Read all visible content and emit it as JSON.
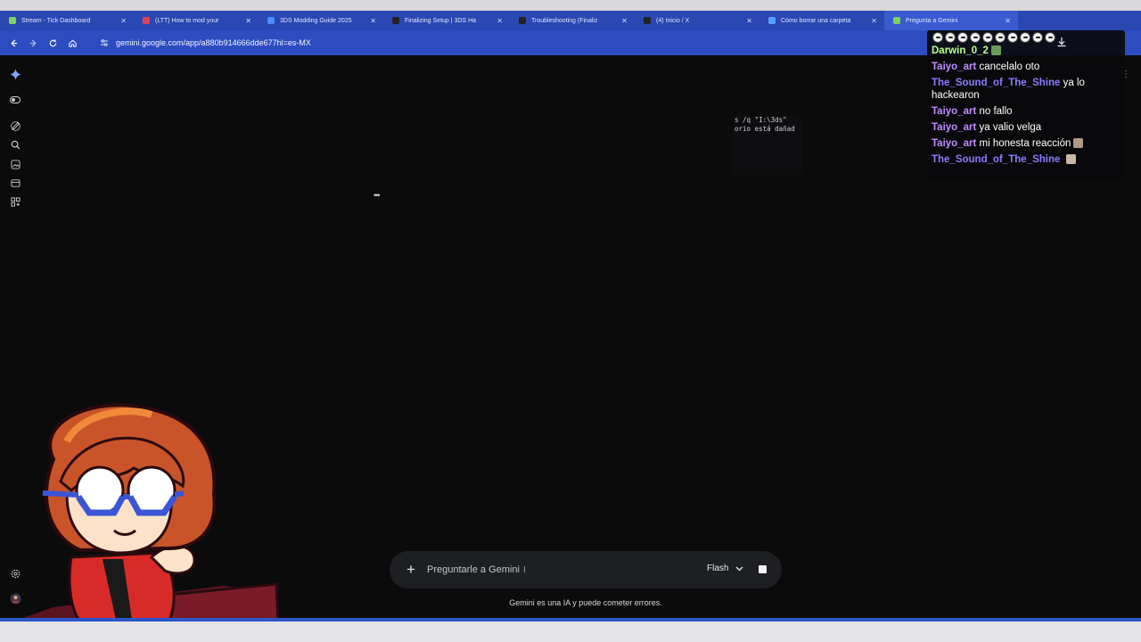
{
  "browser": {
    "tabs": [
      {
        "label": "Stream - Tick Dashboard",
        "color": "#7bd35a"
      },
      {
        "label": "(LTT) How to mod your",
        "color": "#e0405a"
      },
      {
        "label": "3DS Modding Guide 2025",
        "color": "#4a8cff"
      },
      {
        "label": "Finalizing Setup | 3DS Ha",
        "color": "#222222"
      },
      {
        "label": "Troubleshooting (Finaliz",
        "color": "#222222"
      },
      {
        "label": "(4) Inicio / X",
        "color": "#222222"
      },
      {
        "label": "Cómo borrar una carpeta",
        "color": "#5aa0ff"
      },
      {
        "label": "Pregunta a Gemini",
        "color": "#7bd35a"
      }
    ],
    "url": "gemini.google.com/app/a880b914666dde677hl=es-MX",
    "icons": {
      "back": "arrow-left-icon",
      "forward": "arrow-right-icon",
      "reload": "reload-icon",
      "home": "home-icon",
      "site_info": "tune-icon",
      "download": "download-icon",
      "menu": "kebab-icon"
    }
  },
  "rail": {
    "icons": [
      "gemini-star-icon",
      "toggle-icon",
      "new-chat-icon",
      "search-icon",
      "gallery-icon",
      "library-icon",
      "apps-icon",
      "settings-icon",
      "user-avatar-icon"
    ]
  },
  "terminal": {
    "lines": [
      "s /q \"I:\\3ds\"",
      "orio está dañad"
    ]
  },
  "loader_text": "•••",
  "chat": {
    "header_user": "Darwin_0_2",
    "messages": [
      {
        "user": "Taiyo_art",
        "user_color": "#c08cff",
        "text": "cancelalo oto"
      },
      {
        "user": "The_Sound_of_The_Shine",
        "user_color": "#8a7cff",
        "text": "ya lo hackearon"
      },
      {
        "user": "Taiyo_art",
        "user_color": "#c08cff",
        "text": "no fallo"
      },
      {
        "user": "Taiyo_art",
        "user_color": "#c08cff",
        "text": "ya valio velga"
      },
      {
        "user": "Taiyo_art",
        "user_color": "#c08cff",
        "text": "mi honesta reacción"
      },
      {
        "user": "The_Sound_of_The_Shine",
        "user_color": "#8a7cff",
        "text": ""
      }
    ],
    "header_color": "#b9ff8a"
  },
  "prompt": {
    "placeholder": "Preguntarle a Gemini",
    "model": "Flash",
    "disclaimer": "Gemini es una IA y puede cometer errores."
  }
}
